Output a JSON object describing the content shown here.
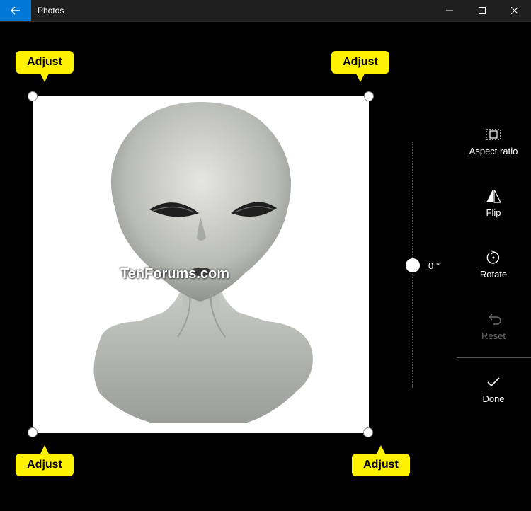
{
  "titlebar": {
    "app_title": "Photos",
    "back_icon": "back-arrow-icon",
    "minimize_icon": "minimize-icon",
    "maximize_icon": "maximize-icon",
    "close_icon": "close-icon",
    "accent_color": "#0078d7"
  },
  "photo": {
    "watermark": "TenForums.com"
  },
  "callouts": {
    "top_left": "Adjust",
    "top_right": "Adjust",
    "bottom_left": "Adjust",
    "bottom_right": "Adjust",
    "color": "#fff200"
  },
  "straighten": {
    "value_label": "0 °"
  },
  "tools": {
    "aspect_ratio": "Aspect ratio",
    "flip": "Flip",
    "rotate": "Rotate",
    "reset": "Reset",
    "done": "Done"
  }
}
